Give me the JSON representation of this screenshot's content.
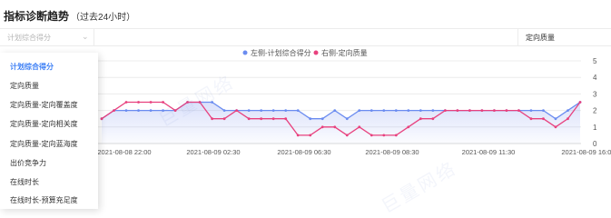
{
  "title": {
    "main": "指标诊断趋势",
    "sub": "（过去24小时）"
  },
  "left_select": {
    "placeholder": "计划综合得分"
  },
  "right_select": {
    "value": "定向质量"
  },
  "dropdown": {
    "items": [
      "计划综合得分",
      "定向质量",
      "定向质量-定向覆盖度",
      "定向质量-定向相关度",
      "定向质量-定向蓝海度",
      "出价竞争力",
      "在线时长",
      "在线时长-预算充足度"
    ],
    "active_index": 0
  },
  "watermark": "巨量网络",
  "colors": {
    "left_series": "#6b8cf0",
    "right_series": "#e8417e",
    "accent": "#3d7ff5"
  },
  "chart_data": {
    "type": "line",
    "x_ticks": [
      "2021-08-08 22:00",
      "2021-08-09 02:30",
      "2021-08-09 06:30",
      "2021-08-09 08:30",
      "2021-08-09 11:30",
      "2021-08-09 16:00"
    ],
    "y_ticks_right": [
      "0",
      "1",
      "2",
      "3",
      "4",
      "5"
    ],
    "ylim": [
      0,
      5
    ],
    "grid": true,
    "legend": "top-center",
    "series": [
      {
        "name": "左侧-计划综合得分",
        "color": "#6b8cf0",
        "values": [
          1.5,
          2,
          2,
          2,
          2,
          2,
          2,
          2.5,
          2.5,
          2.5,
          2,
          2,
          2,
          2,
          2,
          2,
          2,
          1.5,
          1.5,
          2,
          1.5,
          2,
          2,
          2,
          2,
          2,
          2,
          2,
          2,
          2,
          2,
          2,
          2,
          2,
          2,
          2,
          2,
          1.5,
          2,
          2.5
        ]
      },
      {
        "name": "右侧-定向质量",
        "color": "#e8417e",
        "values": [
          1.5,
          2,
          2.5,
          2.5,
          2.5,
          2.5,
          2,
          2.5,
          2.5,
          1.5,
          1.5,
          2,
          1.5,
          1.5,
          1.5,
          1.5,
          0.5,
          0.5,
          1,
          1,
          0.5,
          1,
          0.5,
          0.5,
          0.5,
          1,
          1.5,
          1.5,
          2,
          2,
          2,
          2,
          2,
          2,
          2,
          1.5,
          1.5,
          1,
          1.5,
          2.5
        ]
      }
    ]
  }
}
